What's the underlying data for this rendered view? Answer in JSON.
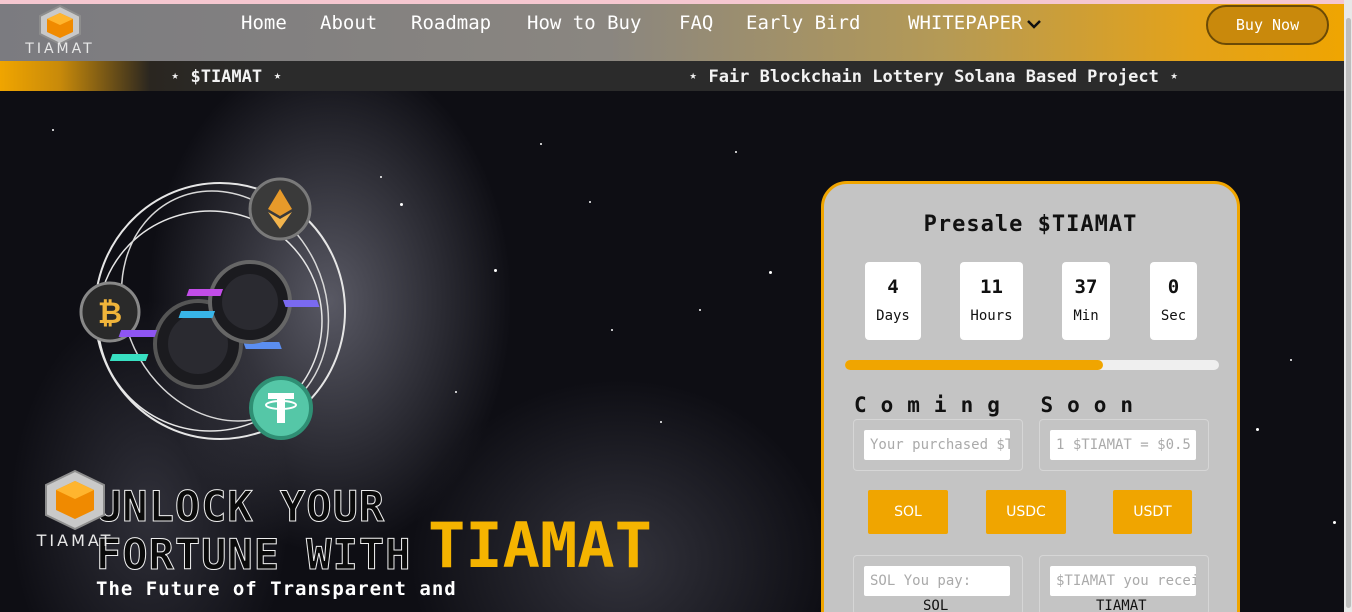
{
  "brand": {
    "name": "TIAMAT"
  },
  "nav": {
    "items": [
      "Home",
      "About",
      "Roadmap",
      "How to Buy",
      "FAQ",
      "Early Bird",
      "WHITEPAPER"
    ],
    "buy_now": "Buy Now"
  },
  "ticker": {
    "item1": "⋆ $TIAMAT ⋆",
    "item2": "⋆ Fair Blockchain Lottery Solana Based Project ⋆"
  },
  "hero": {
    "line1": "UNLOCK YOUR",
    "line2": "FORTUNE WITH",
    "accent": "TIAMAT",
    "subline": "The Future of Transparent and"
  },
  "presale": {
    "title": "Presale $TIAMAT",
    "countdown": [
      {
        "value": "4",
        "label": "Days"
      },
      {
        "value": "11",
        "label": "Hours"
      },
      {
        "value": "37",
        "label": "Min"
      },
      {
        "value": "0",
        "label": "Sec"
      }
    ],
    "progress_fraction": 0.69,
    "status": "Coming Soon",
    "purchased_placeholder": "Your purchased $TIAMAT",
    "rate_placeholder": "1 $TIAMAT = $0.5",
    "currencies": [
      "SOL",
      "USDC",
      "USDT"
    ],
    "pay_placeholder": "SOL You pay:",
    "receive_placeholder": "$TIAMAT you receive",
    "pay_unit": "SOL",
    "receive_unit": "TIAMAT"
  },
  "colors": {
    "accent": "#f0a500",
    "card_bg": "#c4c4c4"
  },
  "icons": [
    "tiamat-logo-icon",
    "chevron-down-icon",
    "ethereum-coin-icon",
    "bitcoin-coin-icon",
    "solana-coin-icon",
    "tether-coin-icon"
  ]
}
